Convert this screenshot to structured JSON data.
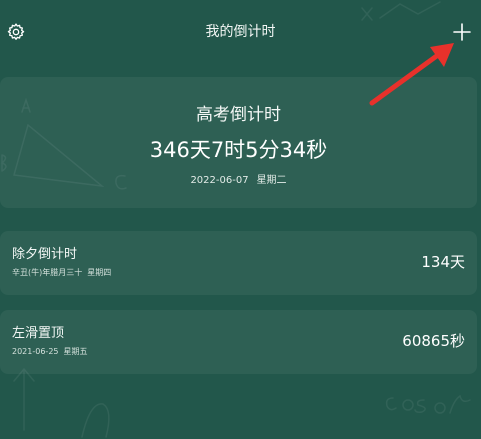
{
  "header": {
    "title": "我的倒计时",
    "settings_icon": "gear-icon",
    "add_icon": "plus-icon"
  },
  "main": {
    "title": "高考倒计时",
    "countdown": "346天7时5分34秒",
    "date": "2022-06-07",
    "weekday": "星期二"
  },
  "events": [
    {
      "name": "除夕倒计时",
      "lunar_date": "辛丑(牛)年腊月三十",
      "weekday": "星期四",
      "value": "134天"
    },
    {
      "name": "左滑置顶",
      "date": "2021-06-25",
      "weekday": "星期五",
      "value": "60865秒"
    }
  ],
  "colors": {
    "background": "#22574b",
    "annotation_arrow": "#e8312b"
  }
}
